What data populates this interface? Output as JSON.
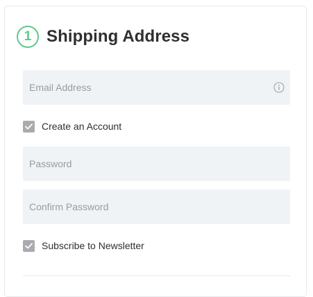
{
  "section": {
    "step_number": "1",
    "title": "Shipping Address"
  },
  "form": {
    "email": {
      "placeholder": "Email Address",
      "value": ""
    },
    "create_account": {
      "label": "Create an Account",
      "checked": true
    },
    "password": {
      "placeholder": "Password",
      "value": ""
    },
    "confirm_password": {
      "placeholder": "Confirm Password",
      "value": ""
    },
    "newsletter": {
      "label": "Subscribe to Newsletter",
      "checked": true
    }
  },
  "colors": {
    "accent": "#5fc98a",
    "field_background": "#f0f3f6",
    "checkbox_checked": "#a9abae",
    "text": "#2f2f2f",
    "placeholder": "#979ba0"
  },
  "icons": {
    "email_hint": "info-circle-icon",
    "checkmark": "checkmark-icon"
  }
}
